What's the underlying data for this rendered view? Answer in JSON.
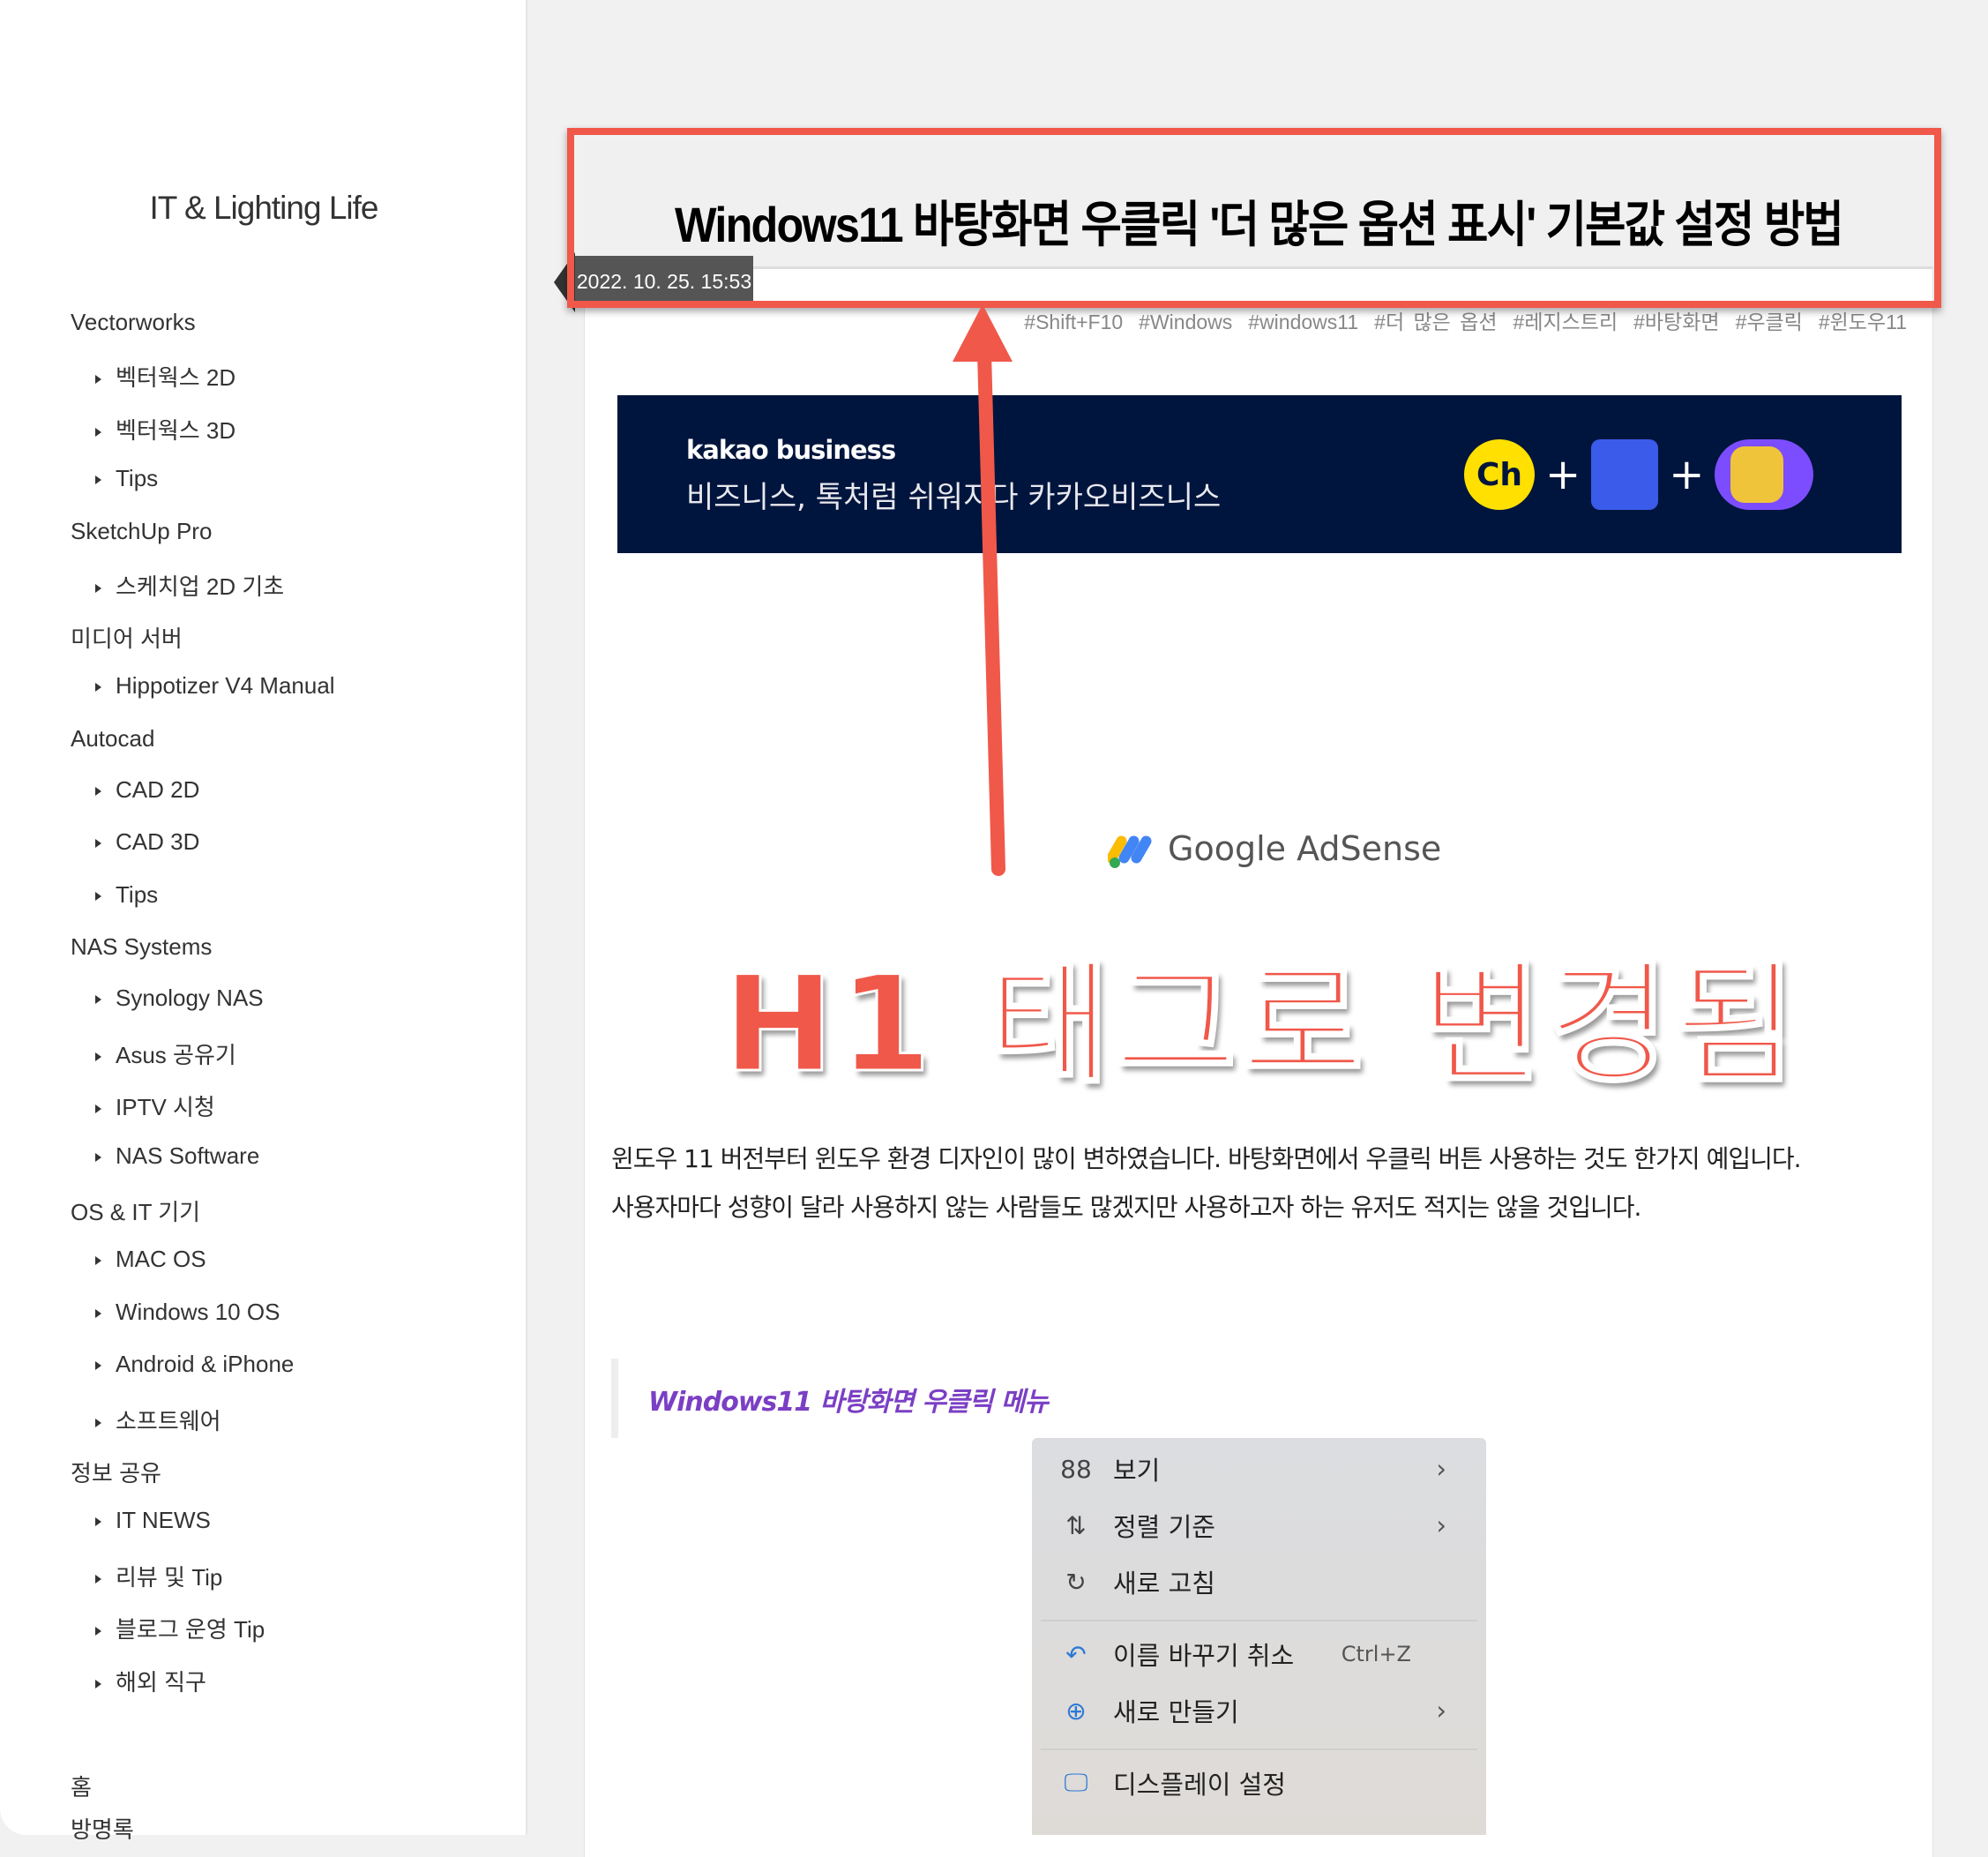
{
  "sidebar": {
    "blog_title": "IT & Lighting Life",
    "categories": [
      {
        "label": "Vectorworks",
        "items": [
          "벡터웍스 2D",
          "벡터웍스 3D",
          "Tips"
        ]
      },
      {
        "label": "SketchUp Pro",
        "items": [
          "스케치업 2D 기초"
        ]
      },
      {
        "label": "미디어 서버",
        "items": [
          "Hippotizer V4 Manual"
        ]
      },
      {
        "label": "Autocad",
        "items": [
          "CAD 2D",
          "CAD 3D",
          "Tips"
        ]
      },
      {
        "label": "NAS Systems",
        "items": [
          "Synology NAS",
          "Asus 공유기",
          "IPTV 시청",
          "NAS Software"
        ]
      },
      {
        "label": "OS & IT 기기",
        "items": [
          "MAC OS",
          "Windows 10 OS",
          "Android & iPhone",
          "소프트웨어"
        ]
      },
      {
        "label": "정보 공유",
        "items": [
          "IT NEWS",
          "리뷰 및 Tip",
          "블로그 운영 Tip",
          "해외 직구"
        ]
      }
    ],
    "links": [
      "홈",
      "방명록"
    ]
  },
  "post": {
    "title": "Windows11 바탕화면 우클릭 '더 많은 옵션 표시' 기본값 설정 방법",
    "date": "2022. 10. 25. 15:53",
    "tags": [
      "#Shift+F10",
      "#Windows",
      "#windows11",
      "#더 많은 옵션",
      "#레지스트리",
      "#바탕화면",
      "#우클릭",
      "#윈도우11"
    ],
    "paragraphs": [
      "윈도우 11 버전부터 윈도우 환경 디자인이 많이 변하였습니다. 바탕화면에서 우클릭 버튼 사용하는 것도 한가지 예입니다.",
      "사용자마다 성향이 달라 사용하지 않는 사람들도 많겠지만 사용하고자 하는 유저도 적지는 않을 것입니다."
    ],
    "quote": "Windows11 바탕화면 우클릭 메뉴"
  },
  "ad": {
    "brand": "kakao business",
    "tagline": "비즈니스, 톡처럼 쉬워지다 카카오비즈니스",
    "icon_text": "Ch",
    "adsense_label": "Google AdSense"
  },
  "annotation": {
    "text": "H1 태그로 변경됨",
    "color": "#f0584a"
  },
  "context_menu": {
    "items": [
      {
        "icon": "grid-icon",
        "glyph": "88",
        "label": "보기",
        "submenu": true
      },
      {
        "icon": "sort-icon",
        "glyph": "⇅",
        "label": "정렬 기준",
        "submenu": true
      },
      {
        "icon": "refresh-icon",
        "glyph": "↻",
        "label": "새로 고침"
      },
      {
        "icon": "undo-icon",
        "glyph": "↶",
        "label": "이름 바꾸기 취소",
        "shortcut": "Ctrl+Z"
      },
      {
        "icon": "new-icon",
        "glyph": "⊕",
        "label": "새로 만들기",
        "submenu": true
      },
      {
        "icon": "display-settings-icon",
        "glyph": "🖵",
        "label": "디스플레이 설정"
      }
    ],
    "chevron": "›"
  },
  "colors": {
    "accent_red": "#f0584a",
    "banner_bg": "#00153d",
    "quote_purple": "#7b3fc4"
  }
}
